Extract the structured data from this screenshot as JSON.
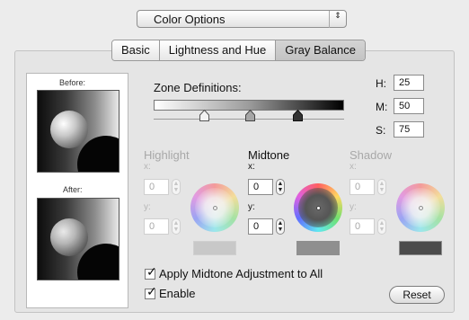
{
  "popup": {
    "value": "Color Options",
    "arrows": "⇕"
  },
  "tabs": [
    {
      "label": "Basic"
    },
    {
      "label": "Lightness and Hue"
    },
    {
      "label": "Gray Balance"
    }
  ],
  "preview": {
    "before_label": "Before:",
    "after_label": "After:"
  },
  "zone": {
    "label": "Zone Definitions:"
  },
  "hms": [
    {
      "label": "H:",
      "value": "25"
    },
    {
      "label": "M:",
      "value": "50"
    },
    {
      "label": "S:",
      "value": "75"
    }
  ],
  "columns": {
    "highlight": {
      "title": "Highlight",
      "x_label": "x:",
      "y_label": "y:",
      "x_value": "0",
      "y_value": "0",
      "swatch_color": "#c8c8c8"
    },
    "midtone": {
      "title": "Midtone",
      "x_label": "x:",
      "y_label": "y:",
      "x_value": "0",
      "y_value": "0",
      "swatch_color": "#8f8f8f"
    },
    "shadow": {
      "title": "Shadow",
      "x_label": "x:",
      "y_label": "y:",
      "x_value": "0",
      "y_value": "0",
      "swatch_color": "#4b4b4b"
    }
  },
  "checkboxes": {
    "apply_all": {
      "label": "Apply Midtone Adjustment to All",
      "checked": true
    },
    "enable": {
      "label": "Enable",
      "checked": true
    }
  },
  "reset_label": "Reset",
  "check_glyph": "✓"
}
